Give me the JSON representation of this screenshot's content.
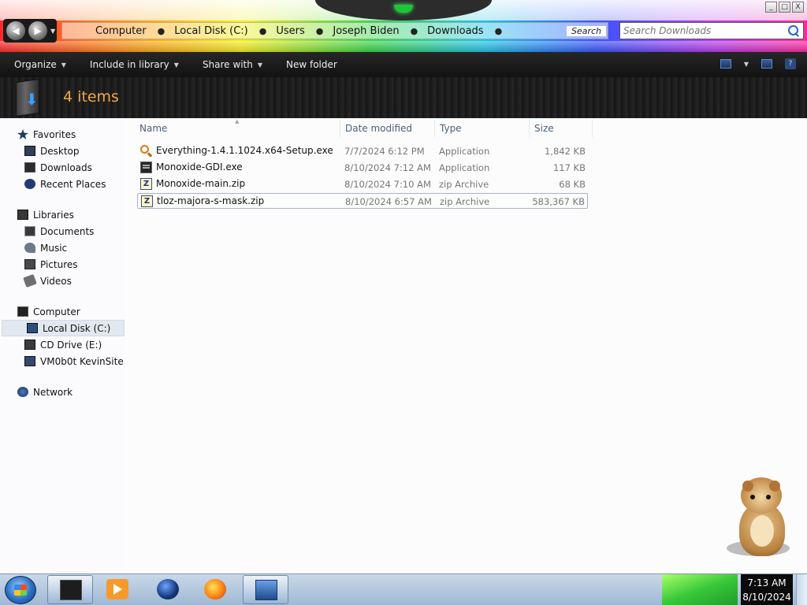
{
  "window": {
    "breadcrumb": [
      "Computer",
      "Local Disk (C:)",
      "Users",
      "Joseph Biden",
      "Downloads"
    ],
    "breadcrumb_search_stub": "Search",
    "search_placeholder": "Search Downloads",
    "buttons": {
      "minimize": "_",
      "maximize": "□",
      "close": "X"
    }
  },
  "toolbar": {
    "organize": "Organize",
    "include_in_library": "Include in library",
    "share_with": "Share with",
    "new_folder": "New folder"
  },
  "details": {
    "item_count": "4 items"
  },
  "sidebar": {
    "favorites": {
      "label": "Favorites",
      "items": [
        {
          "label": "Desktop",
          "icon": "desktop-icon"
        },
        {
          "label": "Downloads",
          "icon": "downloads-icon"
        },
        {
          "label": "Recent Places",
          "icon": "recent-places-icon"
        }
      ]
    },
    "libraries": {
      "label": "Libraries",
      "items": [
        {
          "label": "Documents",
          "icon": "documents-icon"
        },
        {
          "label": "Music",
          "icon": "music-icon"
        },
        {
          "label": "Pictures",
          "icon": "pictures-icon"
        },
        {
          "label": "Videos",
          "icon": "videos-icon"
        }
      ]
    },
    "computer": {
      "label": "Computer",
      "items": [
        {
          "label": "Local Disk (C:)",
          "icon": "disk-icon",
          "selected": true
        },
        {
          "label": "CD Drive (E:)",
          "icon": "cd-drive-icon"
        },
        {
          "label": "VM0b0t KevinSite",
          "icon": "network-drive-icon"
        }
      ]
    },
    "network": {
      "label": "Network"
    }
  },
  "columns": {
    "name": "Name",
    "date": "Date modified",
    "type": "Type",
    "size": "Size"
  },
  "files": [
    {
      "name": "Everything-1.4.1.1024.x64-Setup.exe",
      "date": "7/7/2024 6:12 PM",
      "type": "Application",
      "size": "1,842 KB",
      "icon": "installer-icon"
    },
    {
      "name": "Monoxide-GDI.exe",
      "date": "8/10/2024 7:12 AM",
      "type": "Application",
      "size": "117 KB",
      "icon": "application-icon"
    },
    {
      "name": "Monoxide-main.zip",
      "date": "8/10/2024 7:10 AM",
      "type": "zip Archive",
      "size": "68 KB",
      "icon": "zip-icon"
    },
    {
      "name": "tloz-majora-s-mask.zip",
      "date": "8/10/2024 6:57 AM",
      "type": "zip Archive",
      "size": "583,367 KB",
      "icon": "zip-icon"
    }
  ],
  "taskbar": {
    "apps": [
      "explorer",
      "media-player",
      "globe",
      "firefox",
      "network-connections"
    ],
    "time": "7:13 AM",
    "date": "8/10/2024"
  },
  "colors": {
    "toolbar_bg": "#1b1b1b",
    "item_count": "#f0a848",
    "taskbar": "#b5c9de"
  }
}
